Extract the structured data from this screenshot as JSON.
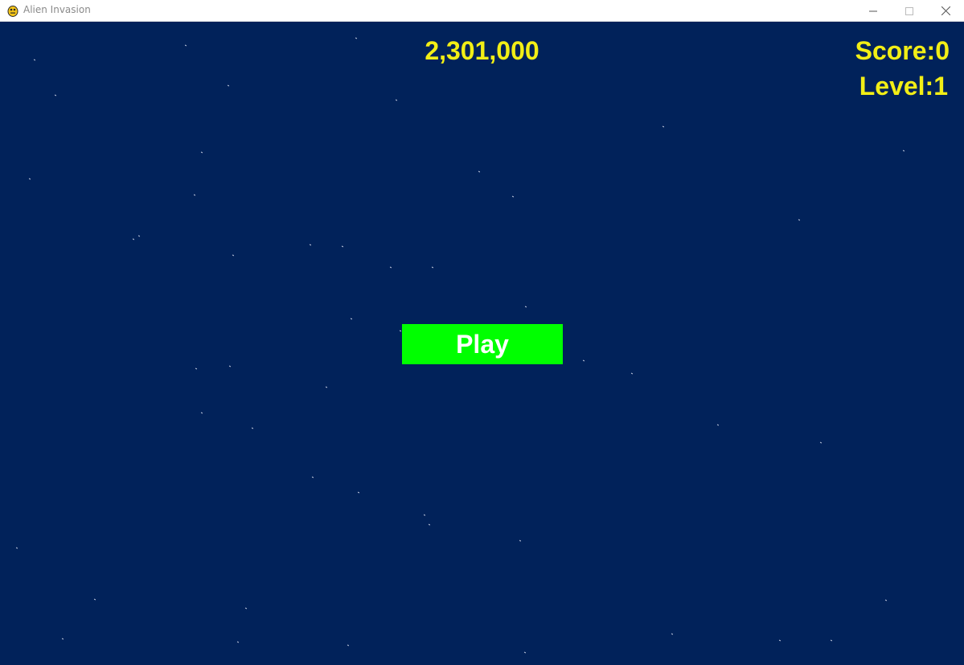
{
  "window": {
    "title": "Alien Invasion",
    "controls": [
      "minimize-icon",
      "maximize-icon",
      "close-icon"
    ]
  },
  "game": {
    "background_color": "#01225a",
    "text_color": "#f2ee16",
    "high_score": "2,301,000",
    "score": "Score:0",
    "level": "Level:1",
    "play_button": {
      "label": "Play",
      "color": "#00ff00",
      "text_color": "#ffffff"
    }
  }
}
